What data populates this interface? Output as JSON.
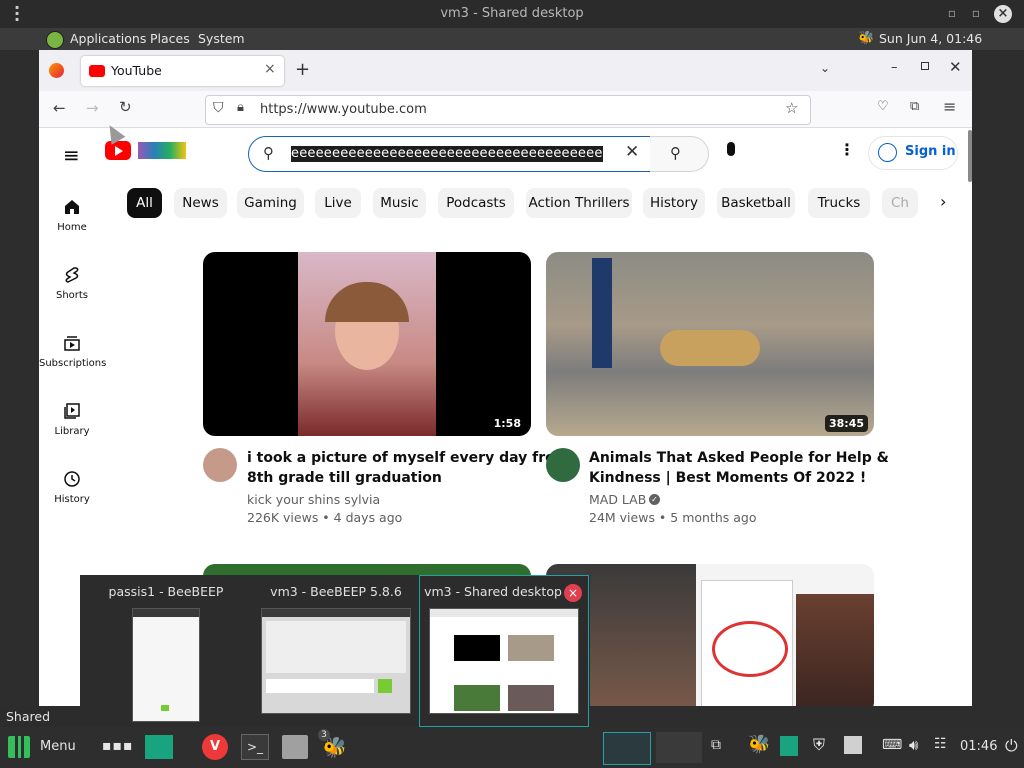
{
  "vm_window": {
    "title": "vm3 - Shared desktop"
  },
  "guest_panel": {
    "applications": "Applications",
    "places": "Places",
    "system": "System",
    "clock": "Sun Jun  4, 01:46"
  },
  "browser": {
    "tab_title": "YouTube",
    "new_tab": "+",
    "url": "https://www.youtube.com"
  },
  "youtube": {
    "search_value": "eeeeeeeeeeeeeeeeeeeeeeeeeeeeeeeeeeeeeeeeeeeee",
    "sign_in": "Sign in",
    "chips": [
      "All",
      "News",
      "Gaming",
      "Live",
      "Music",
      "Podcasts",
      "Action Thrillers",
      "History",
      "Basketball",
      "Trucks",
      "Ch"
    ],
    "sidebar": [
      {
        "label": "Home",
        "icon": "home-icon"
      },
      {
        "label": "Shorts",
        "icon": "shorts-icon"
      },
      {
        "label": "Subscriptions",
        "icon": "subscriptions-icon"
      },
      {
        "label": "Library",
        "icon": "library-icon"
      },
      {
        "label": "History",
        "icon": "history-icon"
      }
    ],
    "videos": [
      {
        "title_line1": "i took a picture of myself every day from",
        "title_line2": "8th grade till graduation",
        "channel": "kick your shins sylvia",
        "meta": "226K views • 4 days ago",
        "duration": "1:58"
      },
      {
        "title_line1": "Animals That Asked People for Help &",
        "title_line2": "Kindness | Best Moments Of 2022 !",
        "channel": "MAD LAB",
        "meta": "24M views • 5 months ago",
        "duration": "38:45"
      }
    ]
  },
  "switcher": {
    "items": [
      {
        "label": "passis1 - BeeBEEP"
      },
      {
        "label": "vm3 - BeeBEEP 5.8.6"
      },
      {
        "label": "vm3 - Shared desktop"
      }
    ]
  },
  "taskbar": {
    "menu_label": "Menu",
    "tooltip": "Shared deskt",
    "beebeep_badge": "3",
    "clock": "01:46"
  }
}
